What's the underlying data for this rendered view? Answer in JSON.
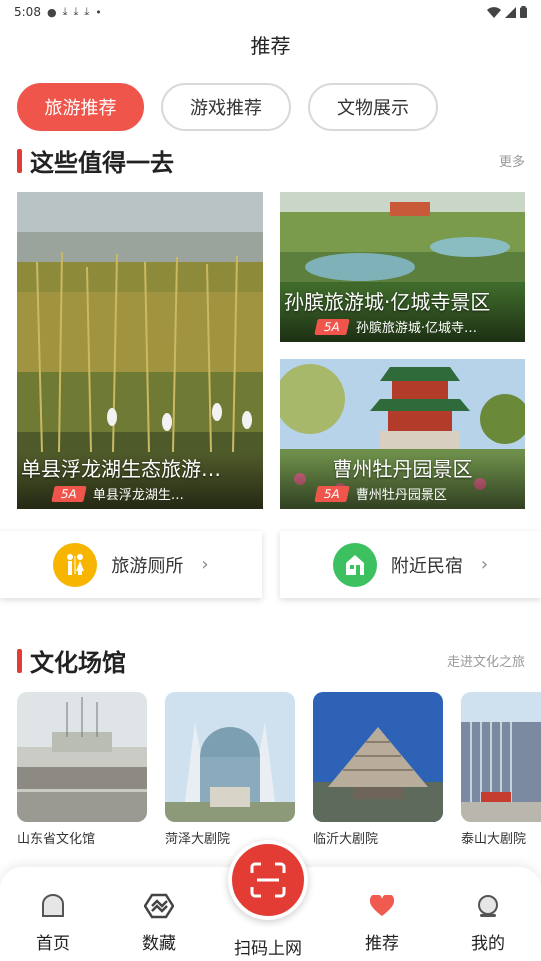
{
  "status_bar": {
    "time": "5:08",
    "notif_icons": [
      "alert-icon",
      "download-icon",
      "download-icon",
      "download-icon",
      "dot-icon"
    ],
    "right_icons": [
      "wifi-icon",
      "signal-icon",
      "battery-icon"
    ]
  },
  "header": {
    "title": "推荐"
  },
  "tabs": [
    {
      "label": "旅游推荐",
      "active": true
    },
    {
      "label": "游戏推荐",
      "active": false
    },
    {
      "label": "文物展示",
      "active": false
    }
  ],
  "section_worth": {
    "title": "这些值得一去",
    "more": "更多"
  },
  "attractions": [
    {
      "name": "单县浮龙湖生态旅游…",
      "badge": "5A",
      "address": "单县浮龙湖生…"
    },
    {
      "name": "孙膑旅游城·亿城寺景区",
      "badge": "5A",
      "address": "孙膑旅游城·亿城寺…"
    },
    {
      "name": "曹州牡丹园景区",
      "badge": "5A",
      "address": "曹州牡丹园景区"
    }
  ],
  "services": [
    {
      "label": "旅游厕所",
      "icon": "toilet-icon",
      "color": "#f7b500"
    },
    {
      "label": "附近民宿",
      "icon": "homestay-icon",
      "color": "#3cc060"
    }
  ],
  "section_culture": {
    "title": "文化场馆",
    "more": "走进文化之旅"
  },
  "venues": [
    {
      "name": "山东省文化馆"
    },
    {
      "name": "菏泽大剧院"
    },
    {
      "name": "临沂大剧院"
    },
    {
      "name": "泰山大剧院"
    }
  ],
  "bottom_nav": {
    "items": [
      {
        "label": "首页",
        "icon": "home-icon"
      },
      {
        "label": "数藏",
        "icon": "collection-icon"
      },
      {
        "label": "推荐",
        "icon": "heart-icon"
      },
      {
        "label": "我的",
        "icon": "profile-icon"
      }
    ],
    "scan_label": "扫码上网",
    "scan_icon": "scan-icon",
    "accent": "#e33c34"
  }
}
